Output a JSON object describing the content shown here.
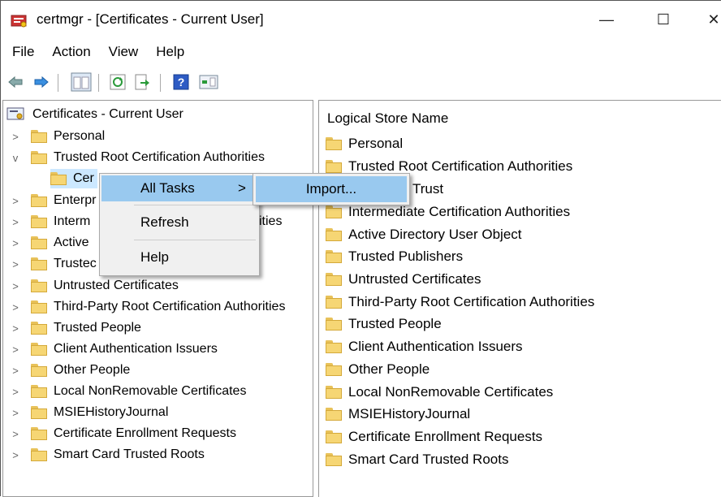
{
  "window": {
    "title": "certmgr - [Certificates - Current User]",
    "minimize_glyph": "—",
    "maximize_glyph": "☐",
    "close_glyph": "✕"
  },
  "menu": [
    "File",
    "Action",
    "View",
    "Help"
  ],
  "toolbar_icons": [
    "back-arrow-icon",
    "forward-arrow-icon",
    "show-hide-tree-icon",
    "refresh-icon",
    "export-list-icon",
    "help-icon",
    "action-pane-icon"
  ],
  "tree": {
    "root": "Certificates - Current User",
    "expanded_child_label": "Cer",
    "items": [
      {
        "label": "Personal",
        "expander": ">"
      },
      {
        "label": "Trusted Root Certification Authorities",
        "expander": "v"
      },
      {
        "label": "Enterpr",
        "expander": ">"
      },
      {
        "label": "Interm",
        "expander": ">"
      },
      {
        "label": "Active",
        "expander": ">"
      },
      {
        "label": "Trustec",
        "expander": ">"
      },
      {
        "label": "Untrusted Certificates",
        "expander": ">"
      },
      {
        "label": "Third-Party Root Certification Authorities",
        "expander": ">"
      },
      {
        "label": "Trusted People",
        "expander": ">"
      },
      {
        "label": "Client Authentication Issuers",
        "expander": ">"
      },
      {
        "label": "Other People",
        "expander": ">"
      },
      {
        "label": "Local NonRemovable Certificates",
        "expander": ">"
      },
      {
        "label": "MSIEHistoryJournal",
        "expander": ">"
      },
      {
        "label": "Certificate Enrollment Requests",
        "expander": ">"
      },
      {
        "label": "Smart Card Trusted Roots",
        "expander": ">"
      }
    ],
    "partial_text_ities": "ities"
  },
  "list": {
    "header": "Logical Store Name",
    "items": [
      "Personal",
      "Trusted Root Certification Authorities",
      "Trust",
      "Intermediate Certification Authorities",
      "Active Directory User Object",
      "Trusted Publishers",
      "Untrusted Certificates",
      "Third-Party Root Certification Authorities",
      "Trusted People",
      "Client Authentication Issuers",
      "Other People",
      "Local NonRemovable Certificates",
      "MSIEHistoryJournal",
      "Certificate Enrollment Requests",
      "Smart Card Trusted Roots"
    ]
  },
  "context_menu": {
    "all_tasks": "All Tasks",
    "submenu_arrow": ">",
    "refresh": "Refresh",
    "help": "Help"
  },
  "submenu": {
    "import": "Import..."
  },
  "colors": {
    "highlight": "#99c9ef",
    "menu_bg": "#f0f0f0",
    "folder": "#f6d674"
  }
}
